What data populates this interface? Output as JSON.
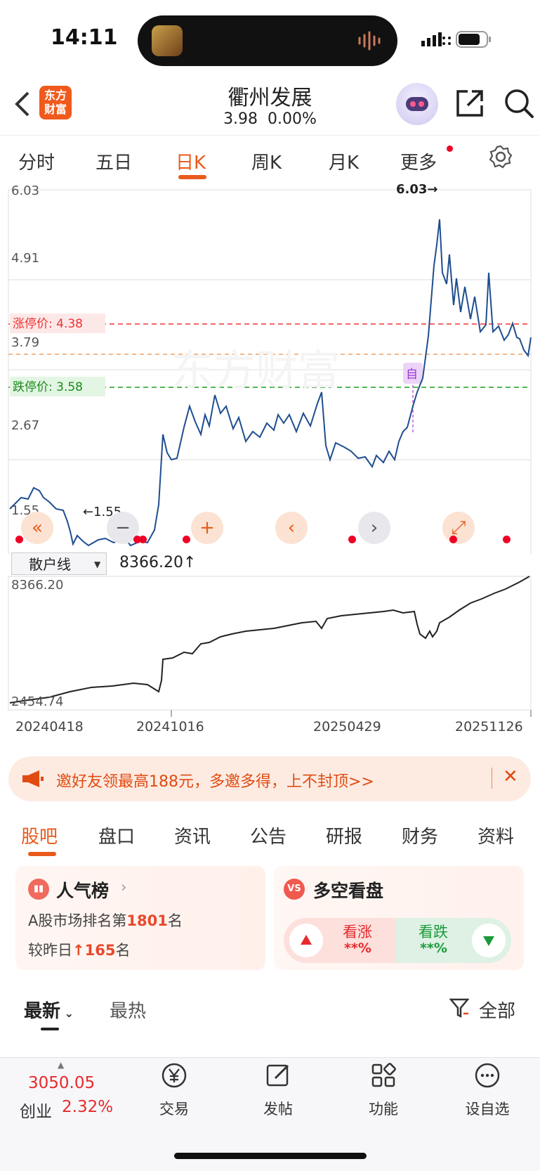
{
  "status_bar": {
    "time": "14:11"
  },
  "header": {
    "logo_text_line1": "东方",
    "logo_text_line2": "财富",
    "stock_name": "衢州发展",
    "price": "3.98",
    "change_pct": "0.00%"
  },
  "period_tabs": [
    {
      "label": "分时"
    },
    {
      "label": "五日"
    },
    {
      "label": "日K"
    },
    {
      "label": "周K"
    },
    {
      "label": "月K"
    },
    {
      "label": "更多"
    }
  ],
  "main_chart": {
    "y_labels": [
      "6.03",
      "4.91",
      "3.79",
      "2.67",
      "1.55"
    ],
    "limit_up_label": "涨停价: 4.38",
    "limit_down_label": "跌停价: 3.58",
    "high_marker": "6.03→",
    "low_marker": "←1.55",
    "self_marker": "自"
  },
  "indicator": {
    "name": "散户线",
    "value": "8366.20↑",
    "y_top": "8366.20",
    "y_bottom": "2454.74",
    "dates": [
      "20240418",
      "20241016",
      "20250429",
      "20251126"
    ]
  },
  "chart_data": [
    {
      "type": "line",
      "title": "",
      "xlabel": "",
      "ylabel": "",
      "ylim": [
        1.55,
        6.03
      ],
      "x": [
        "20240418",
        "20241016",
        "20250429",
        "20251126"
      ],
      "series": [
        {
          "values": [
            2.1,
            1.8,
            1.55,
            1.6,
            2.7,
            3.2,
            3.0,
            3.3,
            2.75,
            2.6,
            3.6,
            6.03,
            4.6,
            4.2,
            3.98
          ]
        }
      ],
      "annotations": [
        "涨停价: 4.38",
        "跌停价: 3.58",
        "6.03",
        "1.55"
      ]
    },
    {
      "type": "line",
      "title": "散户线",
      "ylim": [
        2454.74,
        8366.2
      ],
      "x": [
        "20240418",
        "20241016",
        "20250429",
        "20251126"
      ],
      "series": [
        {
          "name": "散户线",
          "values": [
            2454.74,
            2900,
            3300,
            3150,
            5200,
            5900,
            6300,
            6800,
            7100,
            5900,
            7400,
            8000,
            8366.2
          ]
        }
      ]
    }
  ],
  "banner": {
    "text": "邀好友领最高188元，多邀多得，上不封顶>>"
  },
  "section_tabs": [
    {
      "label": "股吧"
    },
    {
      "label": "盘口"
    },
    {
      "label": "资讯"
    },
    {
      "label": "公告"
    },
    {
      "label": "研报"
    },
    {
      "label": "财务"
    },
    {
      "label": "资料"
    }
  ],
  "popularity_card": {
    "title": "人气榜",
    "rank_prefix": "A股市场排名第",
    "rank": "1801",
    "rank_suffix": "名",
    "change_prefix": "较昨日",
    "change": "165",
    "change_suffix": "名"
  },
  "sentiment_card": {
    "title": "多空看盘",
    "bull_label": "看涨",
    "bull_value": "**%",
    "bear_label": "看跌",
    "bear_value": "**%"
  },
  "feed": {
    "tab_latest": "最新",
    "tab_hot": "最热",
    "filter_label": "全部"
  },
  "bottom_nav": {
    "index_value": "3050.05",
    "index_name": "创业",
    "index_pct": "2.32%",
    "items": [
      {
        "label": "交易"
      },
      {
        "label": "发帖"
      },
      {
        "label": "功能"
      },
      {
        "label": "设自选"
      }
    ]
  },
  "colors": {
    "accent": "#ea5a1c",
    "up": "#e8292c",
    "down": "#1a9a3a",
    "line": "#1f4e8f"
  }
}
